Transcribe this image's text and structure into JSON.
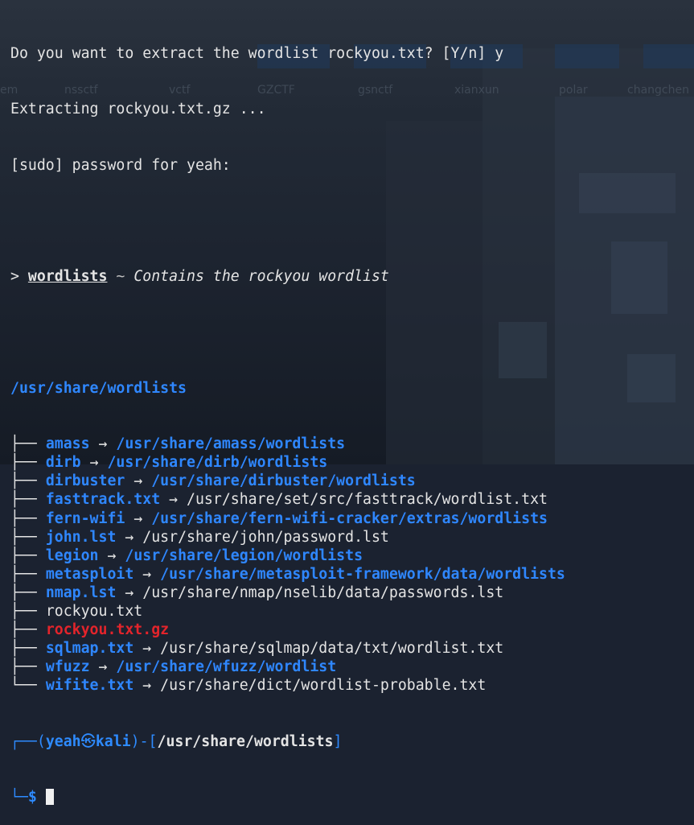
{
  "terminal": {
    "intro": [
      "Do you want to extract the wordlist rockyou.txt? [Y/n] y",
      "Extracting rockyou.txt.gz ...",
      "[sudo] password for yeah:"
    ],
    "background_tags": [
      "nssctf",
      "vctf",
      "GZCTF",
      "gsnctf",
      "xianxun",
      "polar",
      "changchen"
    ],
    "tool_prompt": ">",
    "tool_name": "wordlists",
    "tool_sep": "~",
    "tool_desc": "Contains the rockyou wordlist",
    "root": "/usr/share/wordlists",
    "arrow": "→",
    "tree_mid": "├── ",
    "tree_last": "└── ",
    "entries": [
      {
        "name": "amass",
        "target": "/usr/share/amass/wordlists"
      },
      {
        "name": "dirb",
        "target": "/usr/share/dirb/wordlists"
      },
      {
        "name": "dirbuster",
        "target": "/usr/share/dirbuster/wordlists"
      },
      {
        "name": "fasttrack.txt",
        "target": "/usr/share/set/src/fasttrack/wordlist.txt"
      },
      {
        "name": "fern-wifi",
        "target": "/usr/share/fern-wifi-cracker/extras/wordlists"
      },
      {
        "name": "john.lst",
        "target": "/usr/share/john/password.lst"
      },
      {
        "name": "legion",
        "target": "/usr/share/legion/wordlists"
      },
      {
        "name": "metasploit",
        "target": "/usr/share/metasploit-framework/data/wordlists"
      },
      {
        "name": "nmap.lst",
        "target": "/usr/share/nmap/nselib/data/passwords.lst"
      },
      {
        "name": "rockyou.txt",
        "target": ""
      },
      {
        "name": "rockyou.txt.gz",
        "target": ""
      },
      {
        "name": "sqlmap.txt",
        "target": "/usr/share/sqlmap/data/txt/wordlist.txt"
      },
      {
        "name": "wfuzz",
        "target": "/usr/share/wfuzz/wordlist"
      },
      {
        "name": "wifite.txt",
        "target": "/usr/share/dict/wordlist-probable.txt"
      }
    ],
    "prompt": {
      "corner_top": "┌──(",
      "user": "yeah",
      "at_symbol": "㉿",
      "host": "kali",
      "mid": ")-[",
      "cwd": "/usr/share/wordlists",
      "close": "]",
      "corner_bottom": "└─",
      "symbol": "$"
    },
    "colors": {
      "directory_link": "#2f87ff",
      "archive": "#e3242b",
      "text": "#e4e4e4",
      "prompt": "#2e8bff"
    }
  }
}
